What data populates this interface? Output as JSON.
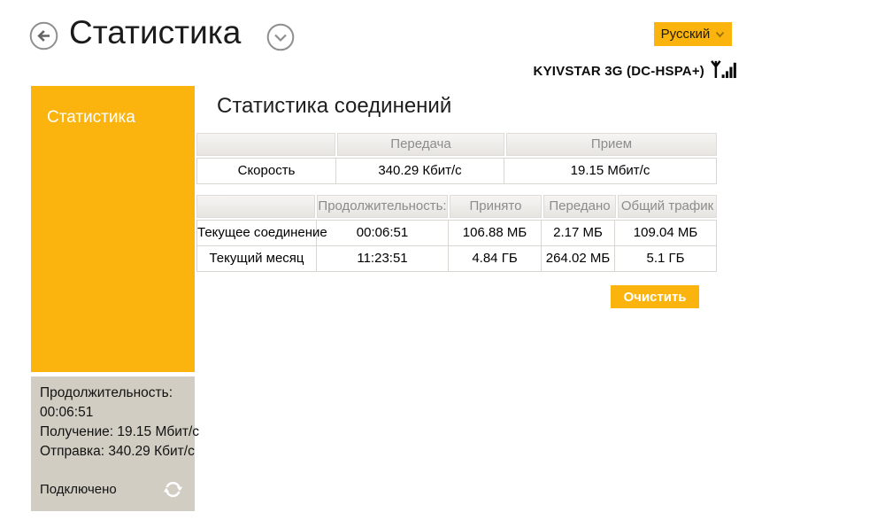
{
  "header": {
    "title": "Статистика",
    "language_button": "Русский",
    "network_name": "KYIVSTAR 3G (DC-HSPA+)"
  },
  "sidebar": {
    "items": [
      {
        "label": "Статистика",
        "active": true
      }
    ],
    "status_panel": {
      "lines": [
        "Продолжительность:",
        "00:06:51",
        "Получение: 19.15 Мбит/с",
        "Отправка: 340.29 Кбит/с"
      ],
      "connection_state": "Подключено"
    }
  },
  "main": {
    "heading": "Статистика соединений",
    "speed_table": {
      "column_headers": [
        "",
        "Передача",
        "Прием"
      ],
      "rows": [
        {
          "label": "Скорость",
          "values": [
            "340.29 Кбит/с",
            "19.15 Мбит/с"
          ]
        }
      ]
    },
    "traffic_table": {
      "column_headers": [
        "",
        "Продолжительность:",
        "Принято",
        "Передано",
        "Общий трафик"
      ],
      "rows": [
        {
          "label": "Текущее соединение",
          "values": [
            "00:06:51",
            "106.88 МБ",
            "2.17 МБ",
            "109.04 МБ"
          ]
        },
        {
          "label": "Текущий месяц",
          "values": [
            "11:23:51",
            "4.84 ГБ",
            "264.02 МБ",
            "5.1 ГБ"
          ]
        }
      ]
    },
    "clear_button_label": "Очистить"
  },
  "icons": {
    "back": "back-arrow-circle",
    "title_dropdown": "chevron-down-circle",
    "language_dropdown": "chevron-down",
    "network": "antenna-signal-bars",
    "refresh": "refresh-arrows"
  },
  "colors": {
    "accent_orange": "#FBB40E",
    "status_panel_gray": "#D1CDC3",
    "table_header_text": "#8C8C8C",
    "table_border": "#D9D6D2"
  }
}
